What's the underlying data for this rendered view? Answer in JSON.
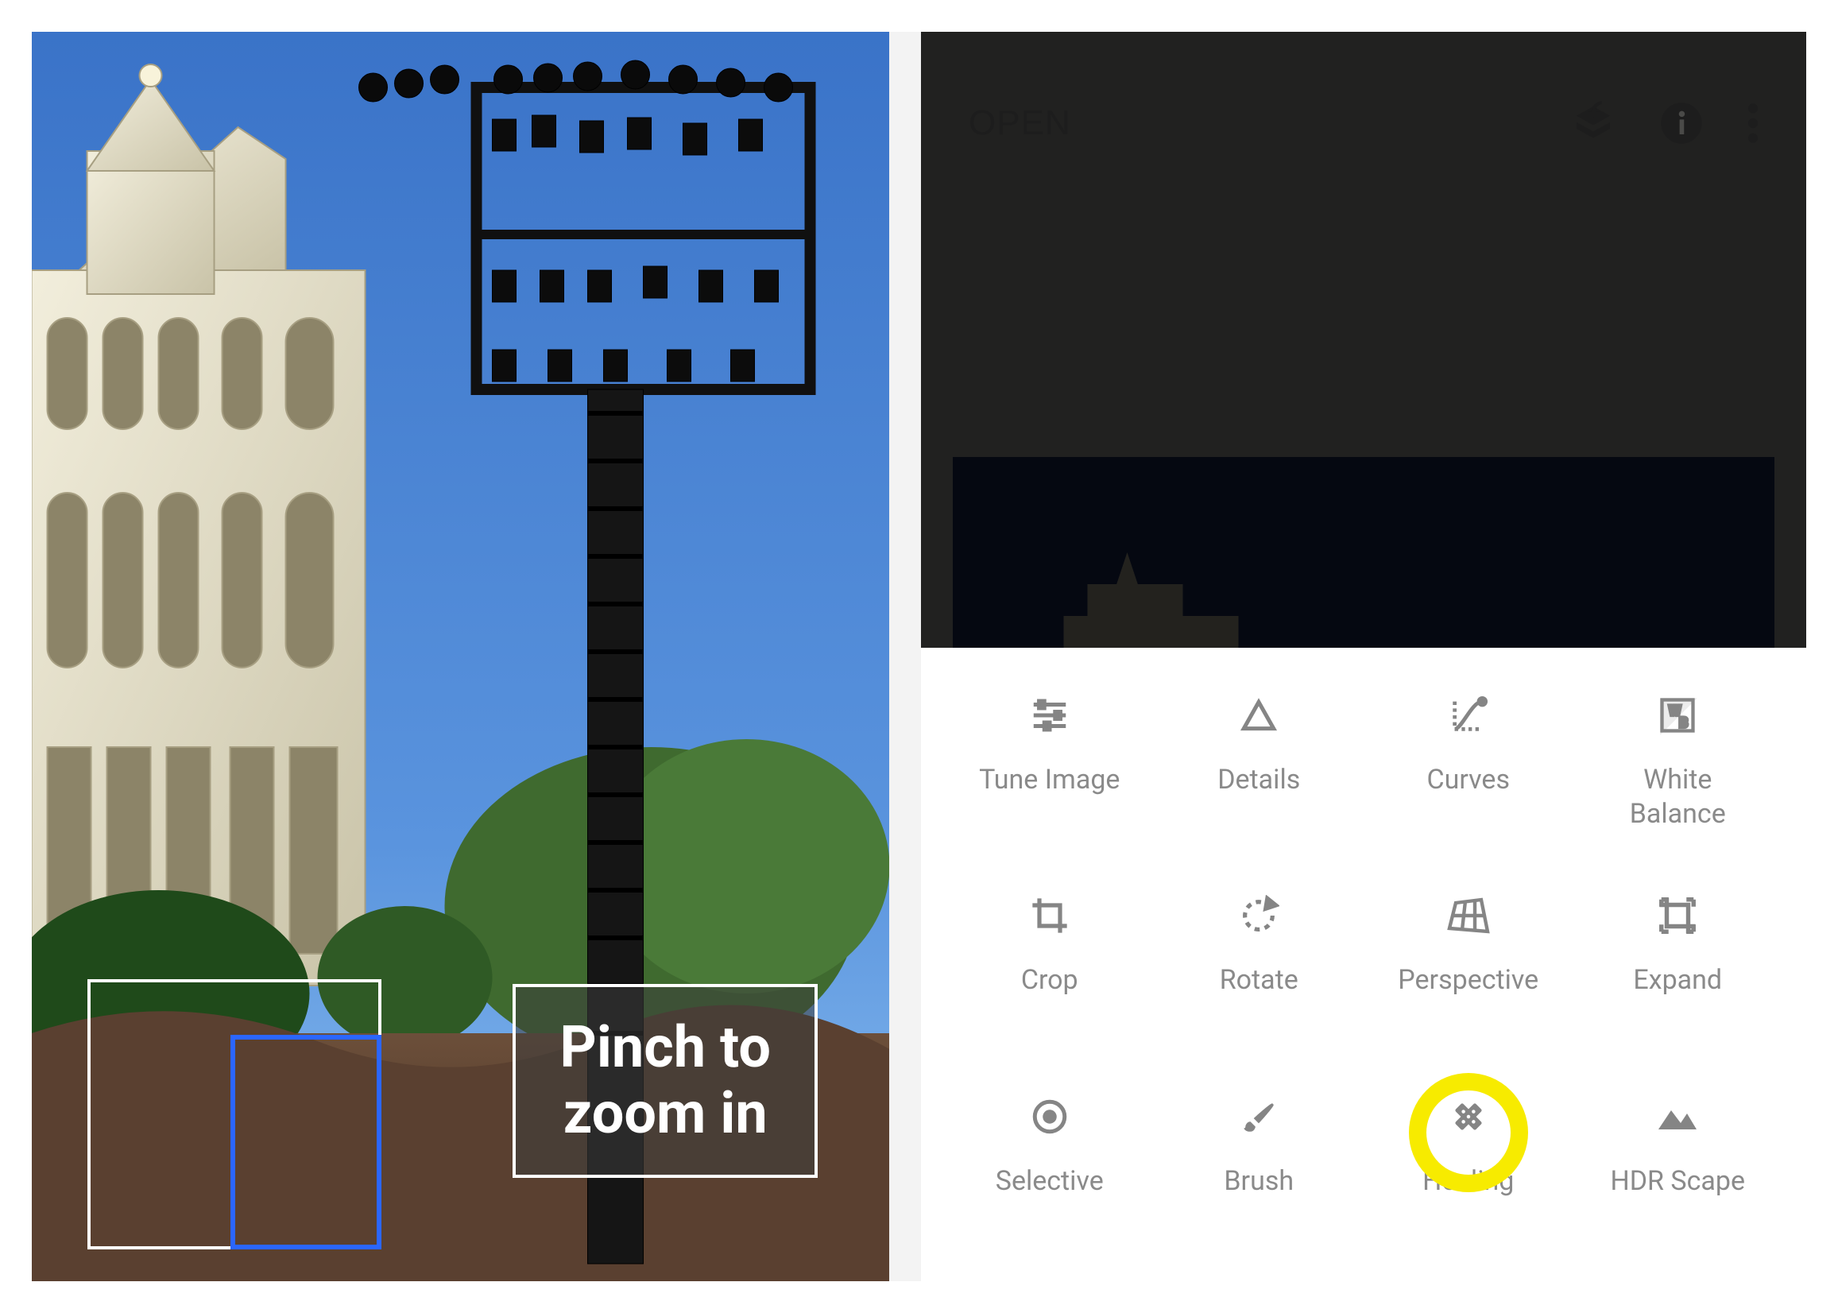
{
  "left_overlay": {
    "line1": "Pinch to",
    "line2": "zoom in"
  },
  "right_header": {
    "open_label": "OPEN"
  },
  "tools": [
    {
      "id": "tune-image",
      "label": "Tune Image"
    },
    {
      "id": "details",
      "label": "Details"
    },
    {
      "id": "curves",
      "label": "Curves"
    },
    {
      "id": "white-balance",
      "label": "White Balance"
    },
    {
      "id": "crop",
      "label": "Crop"
    },
    {
      "id": "rotate",
      "label": "Rotate"
    },
    {
      "id": "perspective",
      "label": "Perspective"
    },
    {
      "id": "expand",
      "label": "Expand"
    },
    {
      "id": "selective",
      "label": "Selective"
    },
    {
      "id": "brush",
      "label": "Brush"
    },
    {
      "id": "healing",
      "label": "Healing"
    },
    {
      "id": "hdr-scape",
      "label": "HDR Scape"
    }
  ],
  "highlighted_tool": "healing"
}
